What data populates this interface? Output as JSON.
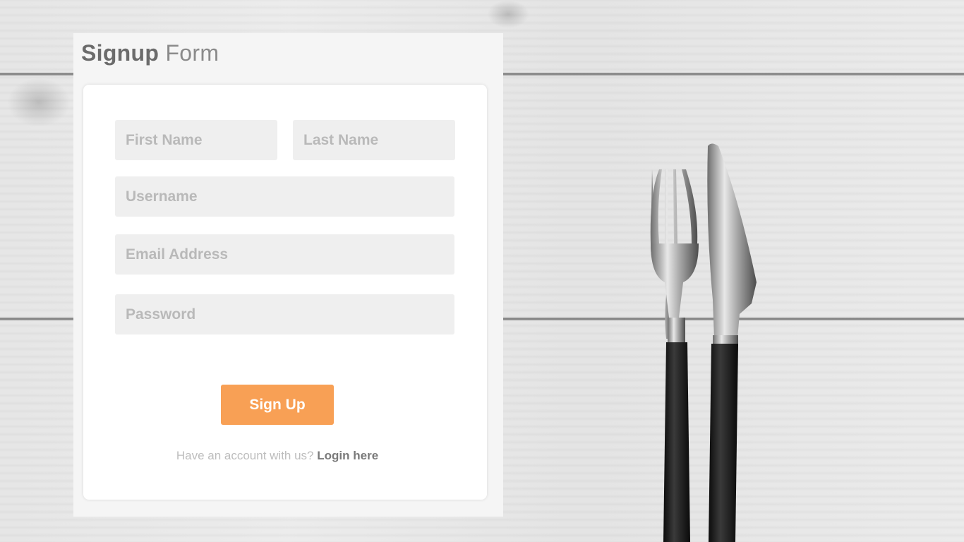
{
  "form": {
    "title_strong": "Signup",
    "title_rest": "Form",
    "first_name_placeholder": "First Name",
    "last_name_placeholder": "Last Name",
    "username_placeholder": "Username",
    "email_placeholder": "Email Address",
    "password_placeholder": "Password",
    "signup_label": "Sign Up",
    "login_prompt": "Have an account with us?",
    "login_link": "Login here"
  },
  "colors": {
    "accent": "#f8a055",
    "field_bg": "#efefef",
    "panel_bg": "#f5f5f5"
  },
  "icons": {
    "fork": "fork-icon",
    "knife": "knife-icon"
  }
}
